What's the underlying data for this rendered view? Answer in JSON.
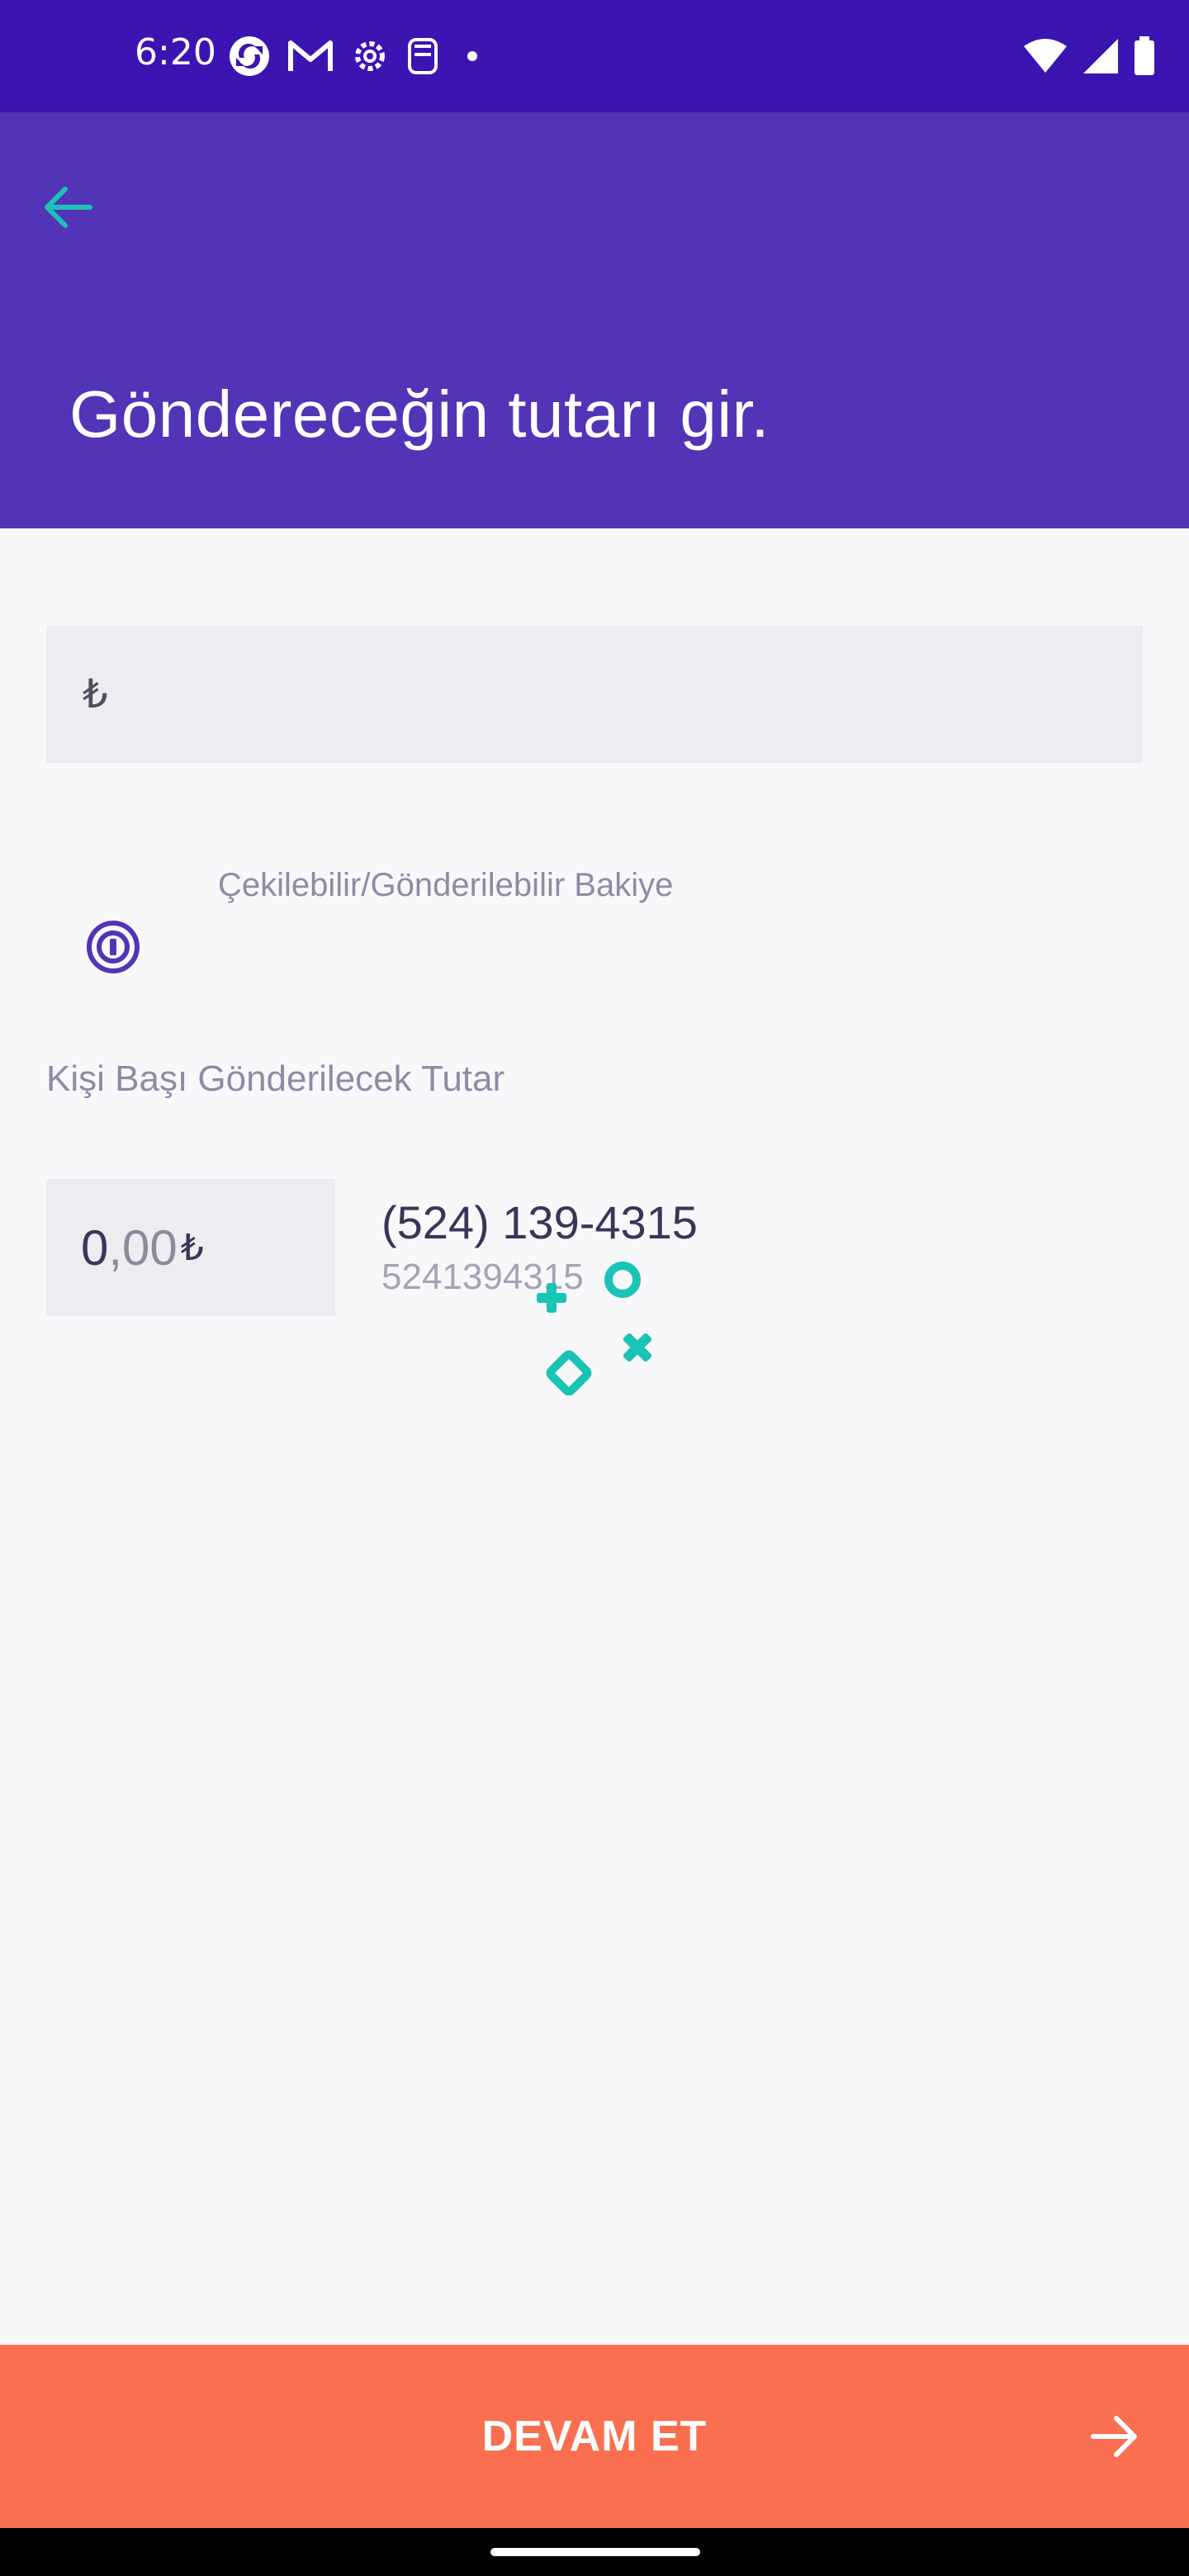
{
  "status_bar": {
    "time": "6:20",
    "left_icons": [
      "sync-icon",
      "gmail-icon",
      "settings-icon",
      "screenshot-icon",
      "dot-icon"
    ],
    "right_icons": [
      "wifi-icon",
      "signal-icon",
      "battery-icon"
    ]
  },
  "header": {
    "title": "Göndereceğin tutarı gir.",
    "back_icon": "arrow-left-icon"
  },
  "amount_field": {
    "currency_symbol": "₺",
    "value": "",
    "placeholder": ""
  },
  "balance": {
    "label": "Çekilebilir/Gönderilebilir Bakiye",
    "icon": "balance-target-icon"
  },
  "per_person": {
    "label": "Kişi Başı Gönderilecek Tutar"
  },
  "recipient": {
    "amount_integer": "0",
    "amount_decimal": ",00",
    "amount_currency": "₺",
    "name": "(524) 139-4315",
    "number": "5241394315"
  },
  "cta": {
    "label": "DEVAM ET",
    "icon": "arrow-right-icon"
  },
  "colors": {
    "status_bar": "#3b14b2",
    "header": "#5333b6",
    "accent_teal": "#19c3b5",
    "cta": "#f96f50",
    "background": "#f8f8fa",
    "field": "#ececf1"
  }
}
